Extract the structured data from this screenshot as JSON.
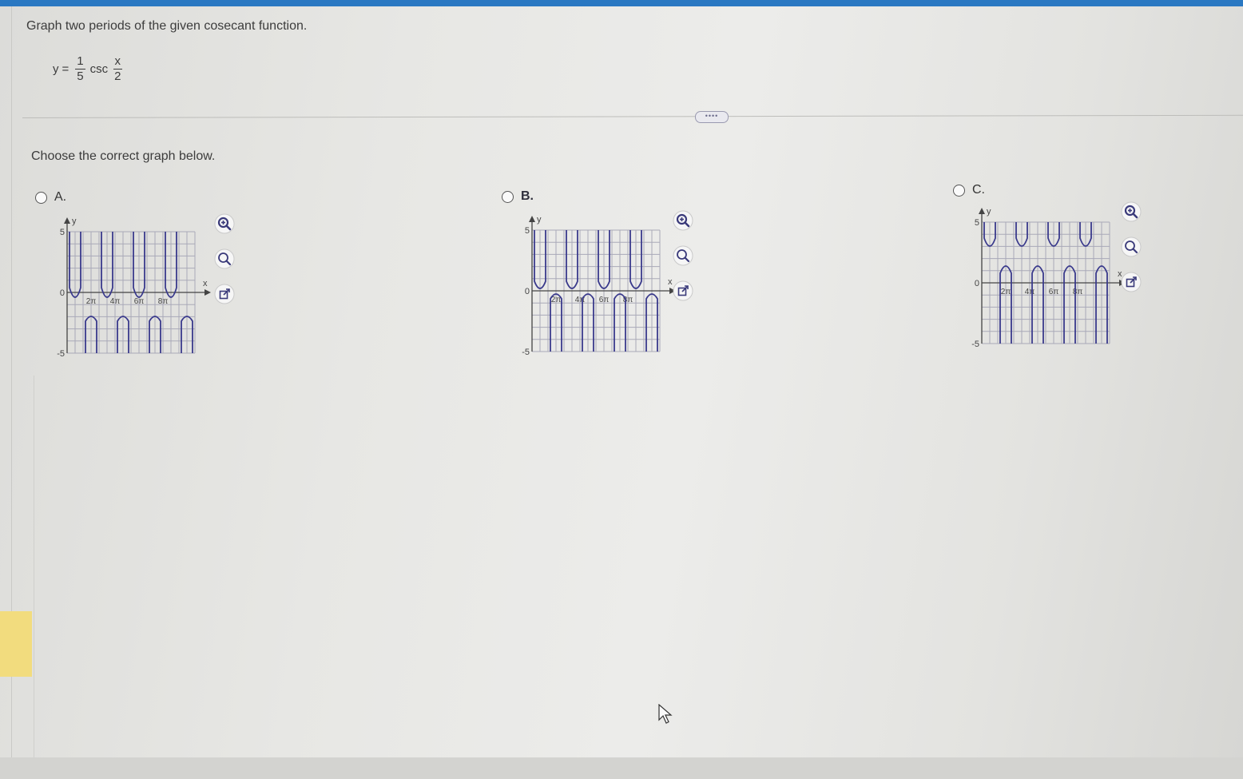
{
  "question": {
    "instruction": "Graph two periods of the given cosecant function.",
    "equation": {
      "lhs": "y",
      "equals": "=",
      "coef_num": "1",
      "coef_den": "5",
      "func": "csc",
      "arg_num": "x",
      "arg_den": "2"
    },
    "more_label": "••••",
    "prompt": "Choose the correct graph below."
  },
  "options": [
    {
      "letter": "A.",
      "selected": false,
      "graph": {
        "y_axis_label": "y",
        "x_axis_label": "x",
        "y_max_label": "5",
        "y_zero_label": "0",
        "y_min_label": "-5",
        "x_tick_labels": [
          "2π",
          "4π",
          "6π",
          "8π"
        ]
      }
    },
    {
      "letter": "B.",
      "selected": false,
      "graph": {
        "y_axis_label": "y",
        "x_axis_label": "x",
        "y_max_label": "5",
        "y_zero_label": "0",
        "y_min_label": "-5",
        "x_tick_labels": [
          "2π",
          "4π",
          "6π",
          "8π"
        ]
      }
    },
    {
      "letter": "C.",
      "selected": false,
      "graph": {
        "y_axis_label": "y",
        "x_axis_label": "x",
        "y_max_label": "5",
        "y_zero_label": "0",
        "y_min_label": "-5",
        "x_tick_labels": [
          "2π",
          "4π",
          "6π",
          "8π"
        ]
      }
    }
  ],
  "tool_icons": [
    "zoom-in-icon",
    "zoom-out-icon",
    "open-new-window-icon"
  ],
  "colors": {
    "accent": "#2a78c2",
    "curve": "#3a3a8c",
    "grid": "#a9a9b8",
    "side_tab": "#f2dc7e"
  }
}
